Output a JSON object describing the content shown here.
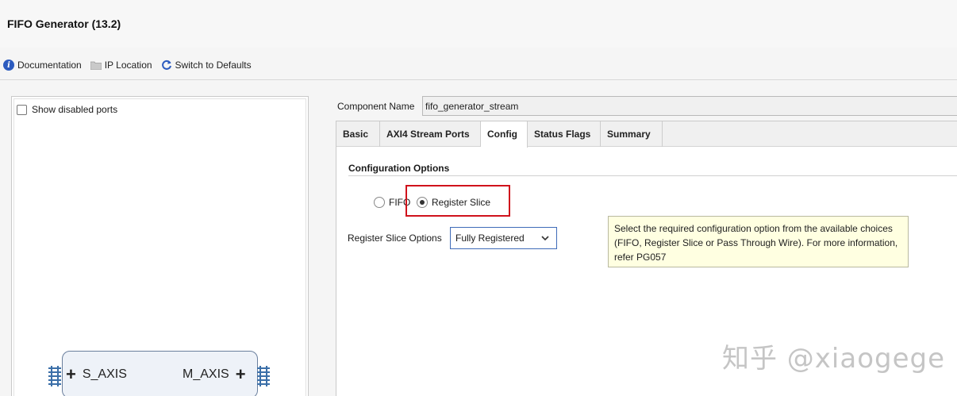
{
  "window": {
    "title": "FIFO Generator (13.2)"
  },
  "toolbar": {
    "documentation": "Documentation",
    "ip_location": "IP Location",
    "switch_defaults": "Switch to Defaults"
  },
  "left_panel": {
    "show_disabled_ports": "Show disabled ports",
    "ports": {
      "s_axis": "S_AXIS",
      "m_axis": "M_AXIS"
    }
  },
  "component": {
    "label": "Component Name",
    "value": "fifo_generator_stream"
  },
  "tabs": [
    {
      "label": "Basic"
    },
    {
      "label": "AXI4 Stream Ports"
    },
    {
      "label": "Config",
      "active": true
    },
    {
      "label": "Status Flags"
    },
    {
      "label": "Summary"
    }
  ],
  "config": {
    "section_title": "Configuration Options",
    "options": {
      "fifo": "FIFO",
      "register_slice": "Register Slice"
    },
    "selected_option": "Register Slice",
    "register_slice_options_label": "Register Slice Options",
    "register_slice_options_value": "Fully Registered"
  },
  "tooltip": {
    "text": "Select the required configuration option from the available choices (FIFO, Register Slice or Pass Through Wire). For more information, refer PG057"
  },
  "watermark": "知乎 @xiaogege",
  "colors": {
    "highlight": "#d0121c",
    "select_border": "#3f6bb8",
    "tooltip_bg": "#ffffe1"
  }
}
